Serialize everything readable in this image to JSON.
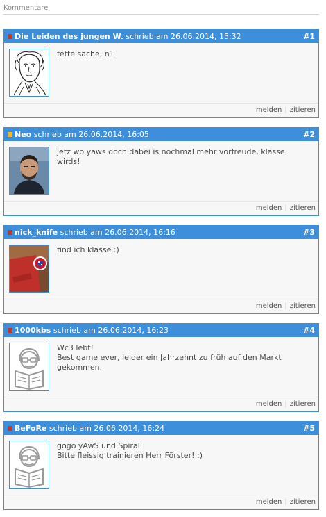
{
  "section_title": "Kommentare",
  "comments": [
    {
      "author": "Die Leiden des jungen W.",
      "meta": " schrieb am 26.06.2014, 15:32",
      "number": "#1",
      "status_color": "#c0392b",
      "avatar": "goethe-portrait",
      "lines": [
        "fette sache, n1"
      ],
      "report": "melden",
      "quote": "zitieren"
    },
    {
      "author": "Neo",
      "meta": " schrieb am 26.06.2014, 16:05",
      "number": "#2",
      "status_color": "#f0b429",
      "avatar": "photo-man",
      "lines": [
        "jetz wo yaws doch dabei is nochmal mehr vorfreude, klasse wirds!"
      ],
      "report": "melden",
      "quote": "zitieren"
    },
    {
      "author": "nick_knife",
      "meta": " schrieb am 26.06.2014, 16:16",
      "number": "#3",
      "status_color": "#c0392b",
      "avatar": "photo-bayern",
      "lines": [
        "find ich klasse :)"
      ],
      "report": "melden",
      "quote": "zitieren"
    },
    {
      "author": "1000kbs",
      "meta": " schrieb am 26.06.2014, 16:23",
      "number": "#4",
      "status_color": "#c0392b",
      "avatar": "default-reader",
      "lines": [
        "Wc3 lebt!",
        "Best game ever, leider ein Jahrzehnt zu früh auf den Markt gekommen."
      ],
      "report": "melden",
      "quote": "zitieren"
    },
    {
      "author": "BeFoRe",
      "meta": " schrieb am 26.06.2014, 16:24",
      "number": "#5",
      "status_color": "#c0392b",
      "avatar": "default-reader",
      "lines": [
        "gogo yAwS und Spiral",
        "Bitte fleissig trainieren Herr Förster! :)"
      ],
      "report": "melden",
      "quote": "zitieren"
    }
  ]
}
